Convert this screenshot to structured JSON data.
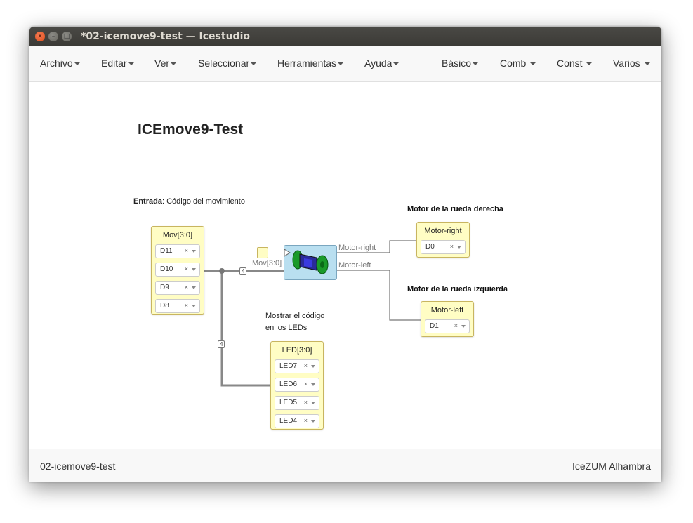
{
  "window": {
    "title": "*02-icemove9-test — Icestudio"
  },
  "menus_left": [
    "Archivo",
    "Editar",
    "Ver",
    "Seleccionar",
    "Herramientas",
    "Ayuda"
  ],
  "menus_right": [
    "Básico",
    "Comb ",
    "Const ",
    "Varios "
  ],
  "diagram": {
    "title": "ICEmove9-Test",
    "entrada_bold": "Entrada",
    "entrada_text": ": Código del movimiento",
    "motor_right_note": "Motor de la rueda derecha",
    "motor_left_note": "Motor de la rueda izquierda",
    "leds_note_line1": "Mostrar el código",
    "leds_note_line2": "en los LEDs",
    "mov_block": {
      "name": "Mov[3:0]",
      "pins": [
        "D11",
        "D10",
        "D9",
        "D8"
      ]
    },
    "led_block": {
      "name": "LED[3:0]",
      "pins": [
        "LED7",
        "LED6",
        "LED5",
        "LED4"
      ]
    },
    "motor_right_block": {
      "name": "Motor-right",
      "pin": "D0"
    },
    "motor_left_block": {
      "name": "Motor-left",
      "pin": "D1"
    },
    "module_input_label": "Mov[3:0]",
    "module_output_right": "Motor-right",
    "module_output_left": "Motor-left",
    "bus_width_label_1": "4",
    "bus_width_label_2": "4",
    "clear_glyph": "×"
  },
  "footer": {
    "project": "02-icemove9-test",
    "board": "IceZUM Alhambra"
  },
  "colors": {
    "block_fill": "#fffdc4",
    "module_fill": "#b9dff0",
    "close_button": "#df4b16"
  }
}
